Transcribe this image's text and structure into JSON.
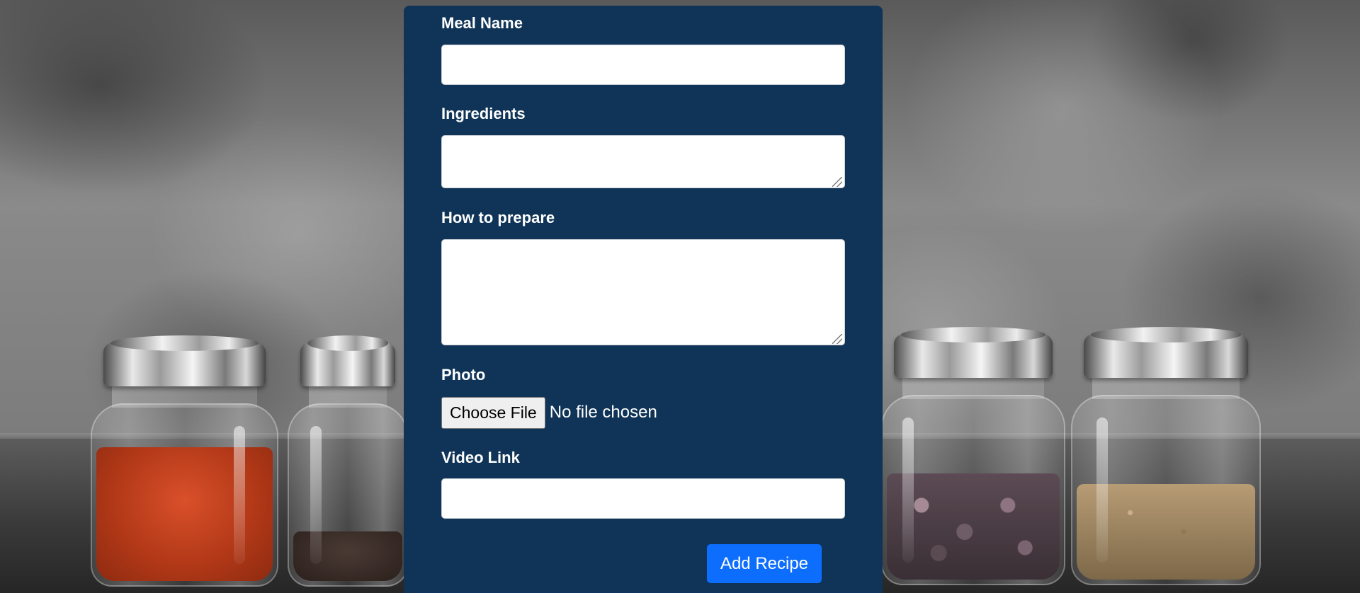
{
  "form": {
    "meal_name": {
      "label": "Meal Name",
      "value": "",
      "placeholder": ""
    },
    "ingredients": {
      "label": "Ingredients",
      "value": "",
      "placeholder": ""
    },
    "how_to_prepare": {
      "label": "How to prepare",
      "value": "",
      "placeholder": ""
    },
    "photo": {
      "label": "Photo",
      "button_label": "Choose File",
      "status": "No file chosen"
    },
    "video_link": {
      "label": "Video Link",
      "value": "",
      "placeholder": ""
    },
    "submit_label": "Add Recipe"
  },
  "colors": {
    "card_background": "#0f3457",
    "submit_button": "#0d6efd",
    "label_text": "#ffffff"
  },
  "icons": {
    "textarea_resize": "resize-grip-icon"
  }
}
